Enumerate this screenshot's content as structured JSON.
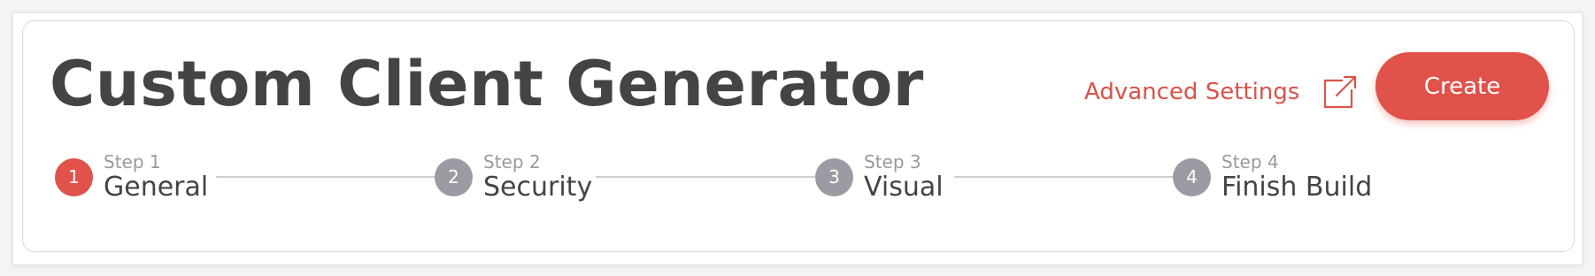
{
  "header": {
    "title": "Custom Client Generator",
    "advanced_settings_label": "Advanced Settings",
    "advanced_settings_icon": "external-link-icon",
    "create_label": "Create"
  },
  "steps": [
    {
      "number": "1",
      "sub": "Step 1",
      "name": "General",
      "active": true
    },
    {
      "number": "2",
      "sub": "Step 2",
      "name": "Security",
      "active": false
    },
    {
      "number": "3",
      "sub": "Step 3",
      "name": "Visual",
      "active": false
    },
    {
      "number": "4",
      "sub": "Step 4",
      "name": "Finish Build",
      "active": false
    }
  ],
  "colors": {
    "accent": "#e0524a",
    "link": "#d9534a",
    "inactive_step": "#9b9ca3",
    "title_text": "#444444"
  }
}
